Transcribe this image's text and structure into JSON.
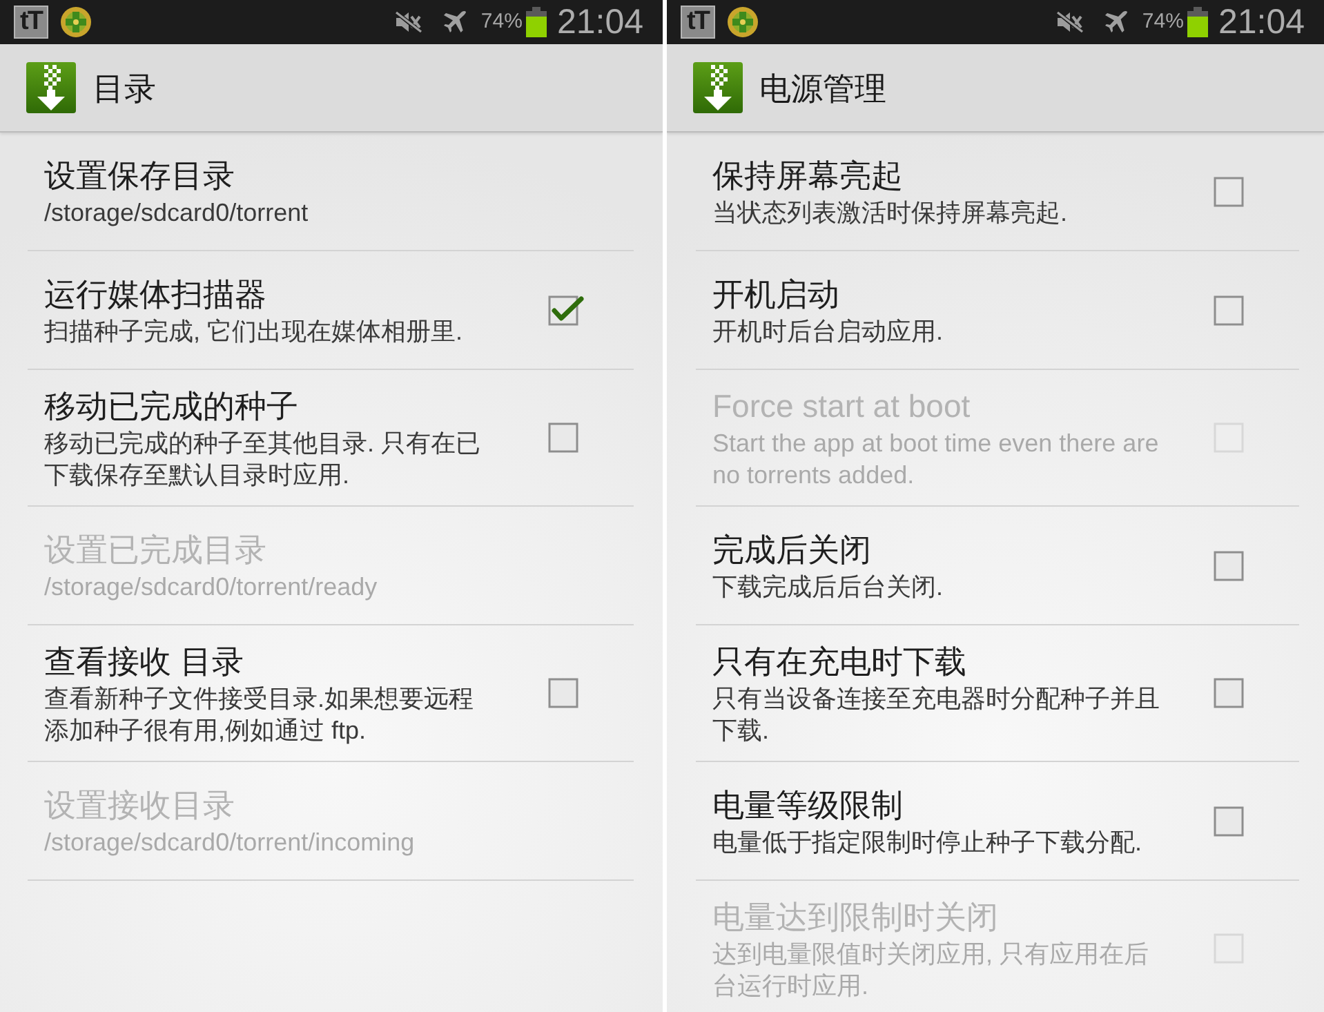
{
  "screens": [
    {
      "status_bar": {
        "notification_icon_text": "tT",
        "battery": "74%",
        "time": "21:04"
      },
      "action_bar": {
        "title": "目录"
      },
      "preferences": [
        {
          "kind": "value",
          "title": "设置保存目录",
          "summary": "/storage/sdcard0/torrent",
          "disabled": false
        },
        {
          "kind": "checkbox",
          "title": "运行媒体扫描器",
          "summary": "扫描种子完成, 它们出现在媒体相册里.",
          "checked": true,
          "disabled": false
        },
        {
          "kind": "checkbox",
          "title": "移动已完成的种子",
          "summary": "移动已完成的种子至其他目录. 只有在已下载保存至默认目录时应用.",
          "checked": false,
          "disabled": false
        },
        {
          "kind": "value",
          "title": "设置已完成目录",
          "summary": "/storage/sdcard0/torrent/ready",
          "disabled": true
        },
        {
          "kind": "checkbox",
          "title": "查看接收 目录",
          "summary": "查看新种子文件接受目录.如果想要远程添加种子很有用,例如通过 ftp.",
          "checked": false,
          "disabled": false
        },
        {
          "kind": "value",
          "title": "设置接收目录",
          "summary": "/storage/sdcard0/torrent/incoming",
          "disabled": true
        }
      ]
    },
    {
      "status_bar": {
        "notification_icon_text": "tT",
        "battery": "74%",
        "time": "21:04"
      },
      "action_bar": {
        "title": "电源管理"
      },
      "preferences": [
        {
          "kind": "checkbox",
          "title": "保持屏幕亮起",
          "summary": "当状态列表激活时保持屏幕亮起.",
          "checked": false,
          "disabled": false
        },
        {
          "kind": "checkbox",
          "title": "开机启动",
          "summary": "开机时后台启动应用.",
          "checked": false,
          "disabled": false
        },
        {
          "kind": "checkbox",
          "title": "Force start at boot",
          "summary": "Start the app at boot time even there are no torrents added.",
          "checked": false,
          "disabled": true
        },
        {
          "kind": "checkbox",
          "title": "完成后关闭",
          "summary": "下载完成后后台关闭.",
          "checked": false,
          "disabled": false
        },
        {
          "kind": "checkbox",
          "title": "只有在充电时下载",
          "summary": "只有当设备连接至充电器时分配种子并且下载.",
          "checked": false,
          "disabled": false
        },
        {
          "kind": "checkbox",
          "title": "电量等级限制",
          "summary": "电量低于指定限制时停止种子下载分配.",
          "checked": false,
          "disabled": false
        },
        {
          "kind": "checkbox",
          "title": "电量达到限制时关闭",
          "summary": "达到电量限值时关闭应用, 只有应用在后台运行时应用.",
          "checked": false,
          "disabled": true
        }
      ]
    }
  ]
}
